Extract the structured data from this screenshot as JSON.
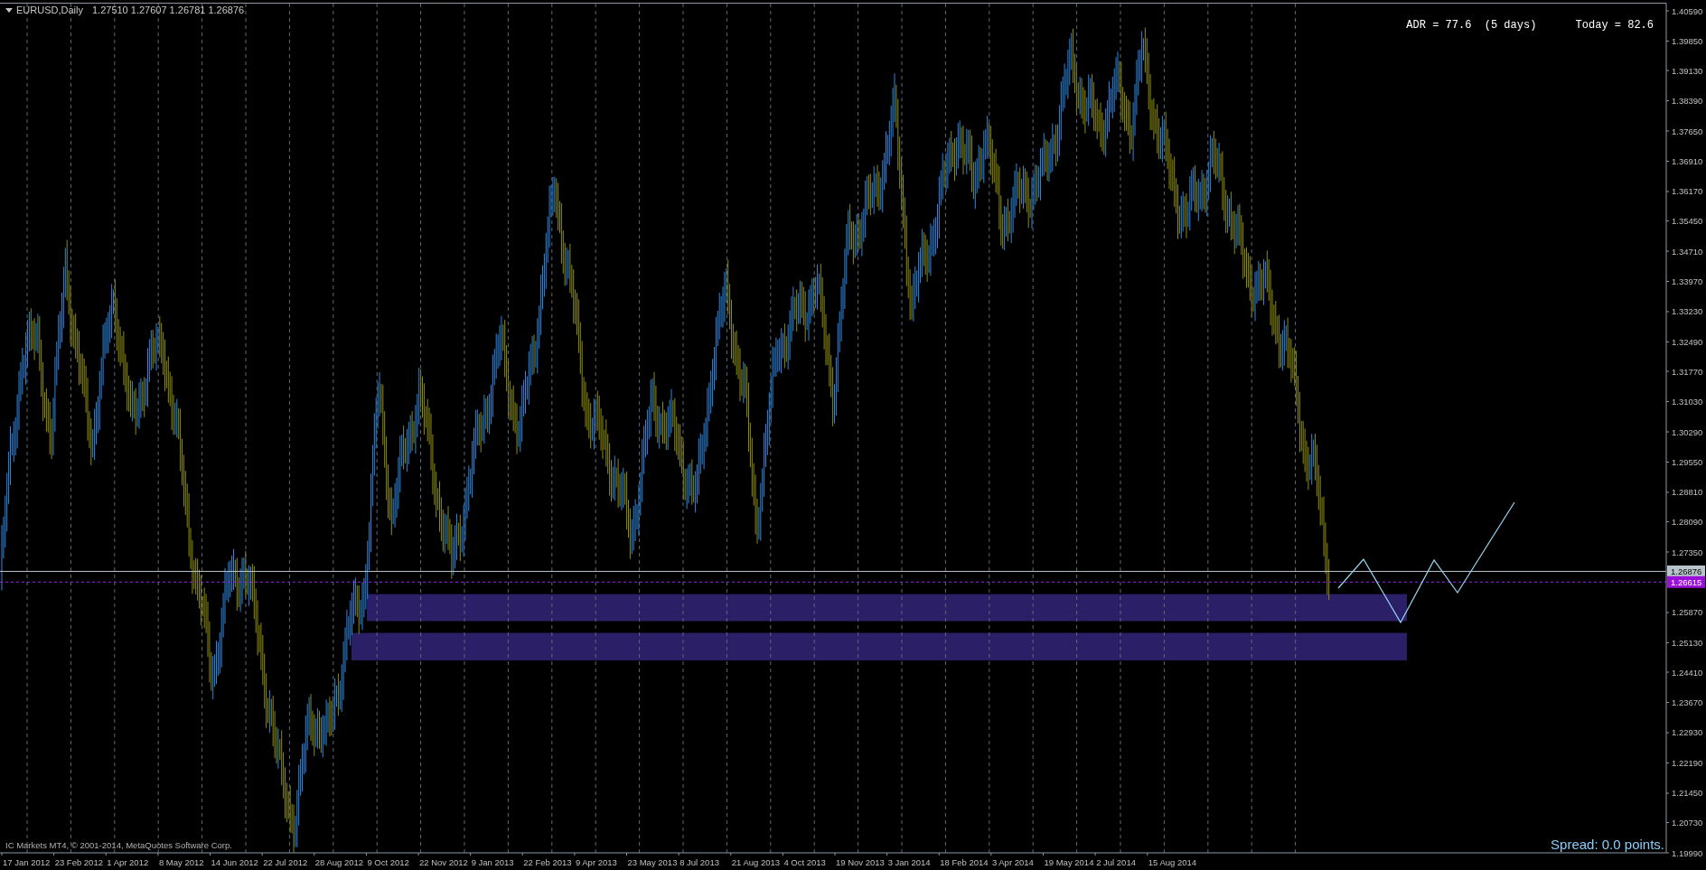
{
  "header": {
    "symbol": "EURUSD,Daily",
    "quotes": "1.27510 1.27607 1.26781 1.26876"
  },
  "adr_text": "ADR = 77.6  (5 days)      Today = 82.6",
  "copyright": "IC Markets MT4, © 2001-2014, MetaQuotes Software Corp.",
  "spread": "Spread: 0.0 points.",
  "price_labels": [
    {
      "text": "1.26876",
      "kind": "bid"
    },
    {
      "text": "1.26615",
      "kind": "level"
    }
  ],
  "chart": {
    "chart_data": {
      "type": "line",
      "grid": true,
      "ylim": [
        1.1999,
        1.4059
      ],
      "categories": [
        "17 Jan 2012",
        "23 Feb 2012",
        "1 Apr 2012",
        "8 May 2012",
        "14 Jun 2012",
        "22 Jul 2012",
        "28 Aug 2012",
        "9 Oct 2012",
        "22 Nov 2012",
        "9 Jan 2013",
        "22 Feb 2013",
        "9 Apr 2013",
        "23 May 2013",
        "8 Jul 2013",
        "21 Aug 2013",
        "4 Oct 2013",
        "19 Nov 2013",
        "3 Jan 2014",
        "18 Feb 2014",
        "3 Apr 2014",
        "19 May 2014",
        "2 Jul 2014",
        "15 Aug 2014",
        null,
        null,
        null,
        null,
        null,
        null,
        null,
        null,
        null
      ],
      "yticks": [
        {
          "value": 1.4059,
          "label": "1.40590"
        },
        {
          "value": 1.3985,
          "label": "1.39850"
        },
        {
          "value": 1.3913,
          "label": "1.39130"
        },
        {
          "value": 1.3839,
          "label": "1.38390"
        },
        {
          "value": 1.3765,
          "label": "1.37650"
        },
        {
          "value": 1.3691,
          "label": "1.36910"
        },
        {
          "value": 1.3617,
          "label": "1.36170"
        },
        {
          "value": 1.3545,
          "label": "1.35450"
        },
        {
          "value": 1.3471,
          "label": "1.34710"
        },
        {
          "value": 1.3397,
          "label": "1.33970"
        },
        {
          "value": 1.3323,
          "label": "1.33230"
        },
        {
          "value": 1.3249,
          "label": "1.32490"
        },
        {
          "value": 1.3177,
          "label": "1.31770"
        },
        {
          "value": 1.3103,
          "label": "1.31030"
        },
        {
          "value": 1.3029,
          "label": "1.30290"
        },
        {
          "value": 1.2955,
          "label": "1.29550"
        },
        {
          "value": 1.2881,
          "label": "1.28810"
        },
        {
          "value": 1.2809,
          "label": "1.28090"
        },
        {
          "value": 1.2735,
          "label": "1.27350"
        },
        {
          "value": 1.2587,
          "label": "1.25870"
        },
        {
          "value": 1.2513,
          "label": "1.25130"
        },
        {
          "value": 1.2441,
          "label": "1.24410"
        },
        {
          "value": 1.2367,
          "label": "1.23670"
        },
        {
          "value": 1.2293,
          "label": "1.22930"
        },
        {
          "value": 1.2219,
          "label": "1.22190"
        },
        {
          "value": 1.2145,
          "label": "1.21450"
        },
        {
          "value": 1.2073,
          "label": "1.20730"
        },
        {
          "value": 1.1999,
          "label": "1.19990"
        }
      ]
    }
  }
}
